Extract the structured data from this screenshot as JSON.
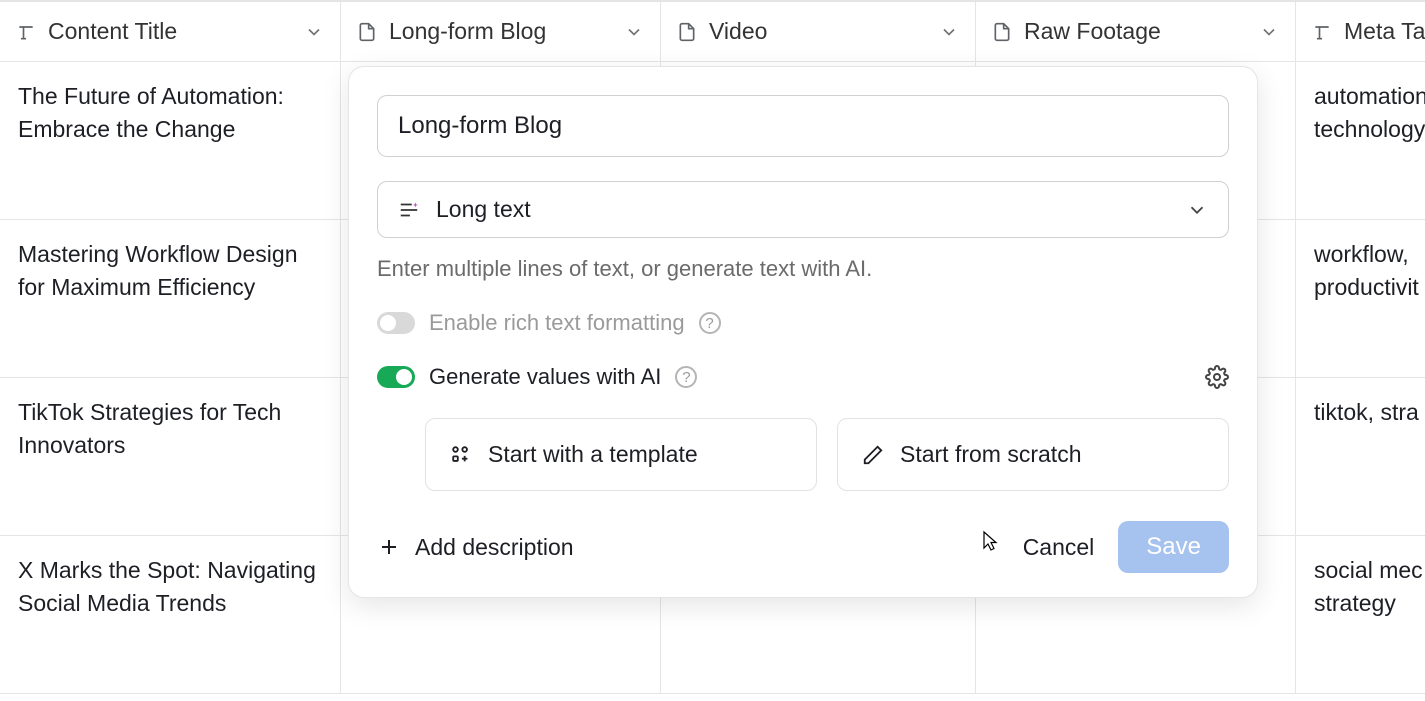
{
  "columns": [
    {
      "label": "Content Title",
      "type": "text"
    },
    {
      "label": "Long-form Blog",
      "type": "attachment"
    },
    {
      "label": "Video",
      "type": "attachment"
    },
    {
      "label": "Raw Footage",
      "type": "attachment"
    },
    {
      "label": "Meta Ta",
      "type": "text"
    }
  ],
  "rows": [
    {
      "title": "The Future of Automation: Embrace the Change",
      "meta": "automation technology"
    },
    {
      "title": "Mastering Workflow Design for Maximum Efficiency",
      "meta": "workflow, productivit"
    },
    {
      "title": "TikTok Strategies for Tech Innovators",
      "meta": "tiktok, stra"
    },
    {
      "title": "X Marks the Spot: Navigating Social Media Trends",
      "meta": "social mec strategy"
    }
  ],
  "popup": {
    "field_name": "Long-form Blog",
    "type_label": "Long text",
    "helper_text": "Enter multiple lines of text, or generate text with AI.",
    "rich_text_label": "Enable rich text formatting",
    "rich_text_enabled": false,
    "ai_generate_label": "Generate values with AI",
    "ai_generate_enabled": true,
    "template_label": "Start with a template",
    "scratch_label": "Start from scratch",
    "add_description_label": "Add description",
    "cancel_label": "Cancel",
    "save_label": "Save"
  },
  "colors": {
    "toggle_on": "#18a957",
    "save_button": "#a6c2ef"
  }
}
